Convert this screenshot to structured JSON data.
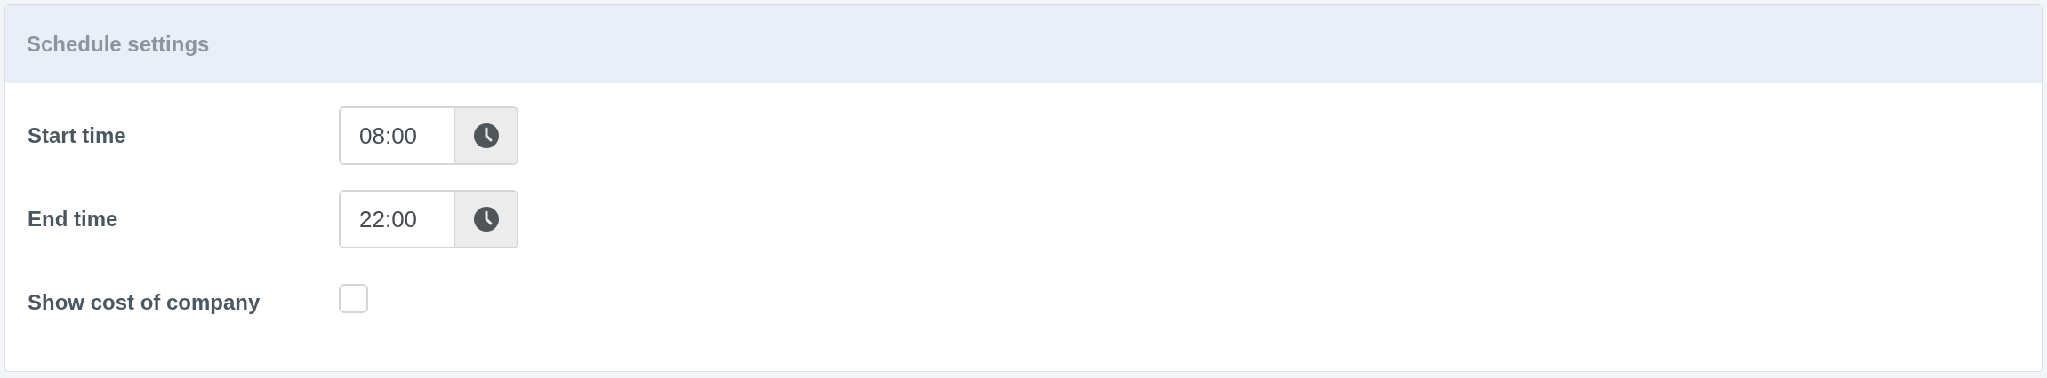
{
  "panel": {
    "title": "Schedule settings"
  },
  "fields": [
    {
      "kind": "time",
      "label": "Start time",
      "value": "08:00"
    },
    {
      "kind": "time",
      "label": "End time",
      "value": "22:00"
    },
    {
      "kind": "checkbox",
      "label": "Show cost of company",
      "checked": false
    }
  ]
}
